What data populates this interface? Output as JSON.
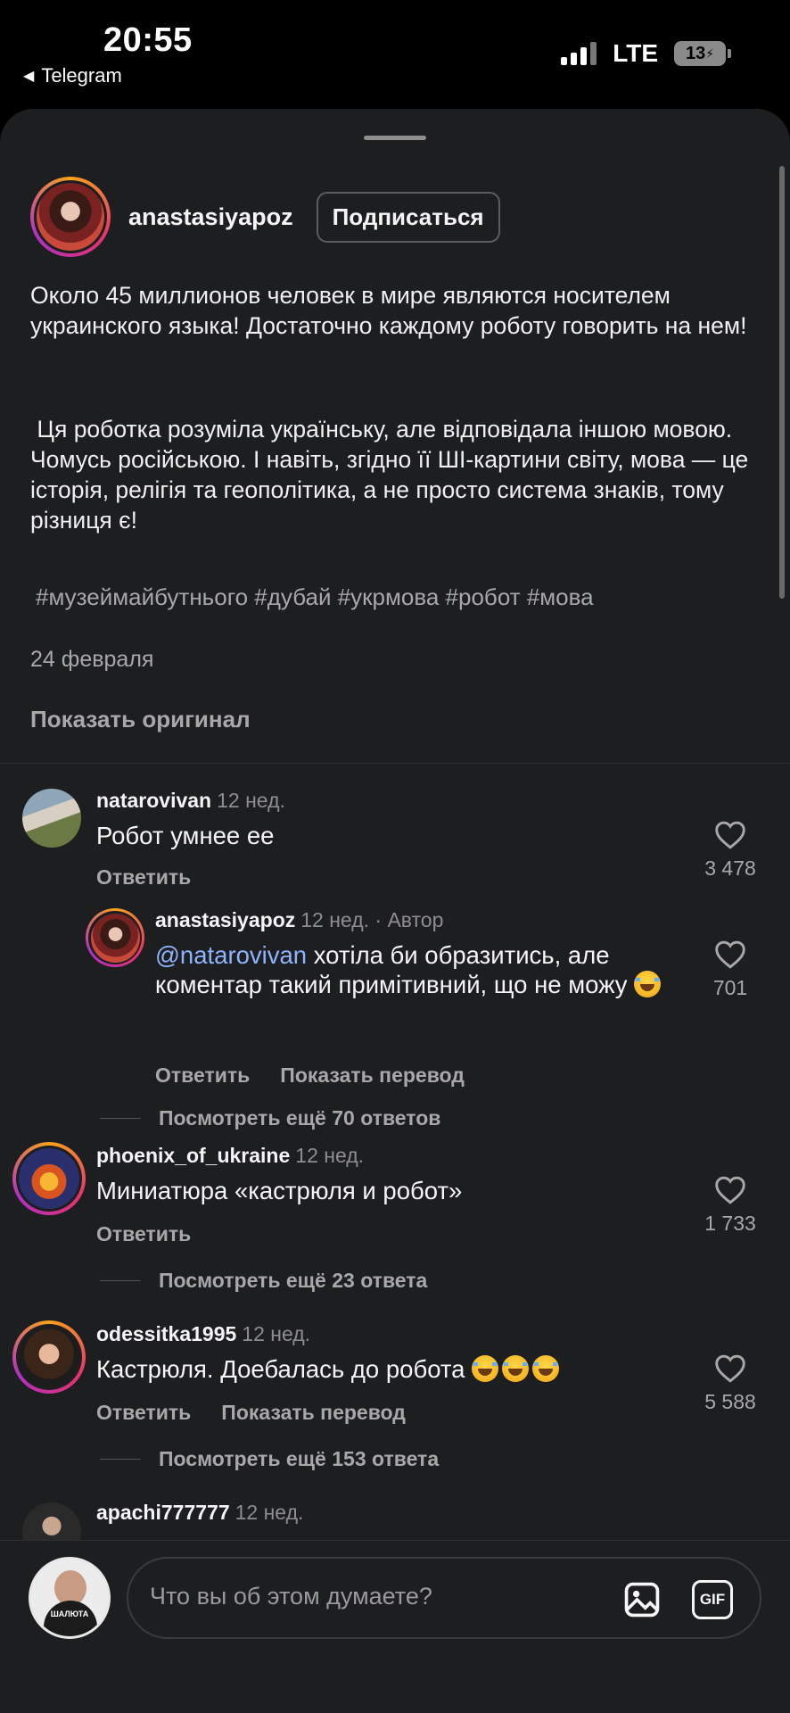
{
  "status_bar": {
    "time": "20:55",
    "back_app": "Telegram",
    "network": "LTE",
    "battery": "13"
  },
  "post": {
    "username": "anastasiyapoz",
    "follow_label": "Подписаться",
    "caption_1": "Около 45 миллионов человек в мире являются носителем украинского языка! Достаточно каждому роботу говорить на нем!",
    "caption_2": " Ця роботка розуміла українську, але відповідала іншою мовою. Чомусь російською. І навіть, згідно її ШІ-картини світу, мова — це історія, релігія та геополітика, а не просто система знаків, тому різниця є!",
    "hashtags": "#музеймайбутнього #дубай #укрмова #робот #мова",
    "date": "24 февраля",
    "show_original": "Показать оригинал"
  },
  "comments": [
    {
      "username": "natarovivan",
      "time": "12 нед.",
      "text": "Робот умнее ее",
      "reply_label": "Ответить",
      "likes": "3 478"
    },
    {
      "username": "anastasiyapoz",
      "time": "12 нед. · Автор",
      "mention": "@natarovivan",
      "text": " хотіла би образитись, але коментар такий примітивний, що не можу",
      "reply_label": "Ответить",
      "translate_label": "Показать перевод",
      "likes": "701",
      "more_replies": "Посмотреть ещё 70 ответов"
    },
    {
      "username": "phoenix_of_ukraine",
      "time": "12 нед.",
      "text": "Миниатюра «кастрюля и робот»",
      "reply_label": "Ответить",
      "likes": "1 733",
      "more_replies": "Посмотреть ещё 23 ответа"
    },
    {
      "username": "odessitka1995",
      "time": "12 нед.",
      "text": "Кастрюля. Доебалась до робота",
      "reply_label": "Ответить",
      "translate_label": "Показать перевод",
      "likes": "5 588",
      "more_replies": "Посмотреть ещё 153 ответа"
    },
    {
      "username": "apachi777777",
      "time": "12 нед."
    }
  ],
  "composer": {
    "placeholder": "Что вы об этом думаете?",
    "gif_label": "GIF",
    "avatar_text": "ШАЛЮТА"
  },
  "icons": {
    "heart": "heart-icon",
    "image": "image-icon",
    "gif": "gif-icon"
  },
  "colors": {
    "background": "#1d1e20",
    "mention": "#8fb4ff",
    "secondary_text": "#a8a8a8"
  }
}
